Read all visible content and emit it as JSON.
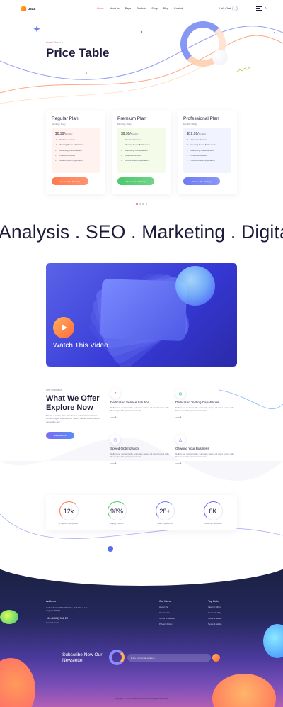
{
  "header": {
    "logo_text": "ucas",
    "nav": [
      "Home",
      "About us",
      "Page",
      "Portfolio",
      "Shop",
      "Blog",
      "Contact"
    ],
    "active_nav": "Home",
    "chat_label": "Let's Chat",
    "icons": [
      "menu-icon",
      "search-icon"
    ]
  },
  "hero": {
    "breadcrumb_home": "Home",
    "breadcrumb_sep": "/",
    "breadcrumb_current": "About Us",
    "title": "Price Table"
  },
  "pricing": {
    "plans": [
      {
        "name": "Regular Plan",
        "period": "Monthly / Daily",
        "price": "$0.99/",
        "price_unit": "Monthly",
        "features": [
          "10 Hours Access",
          "Meeting Room $2/Hr Hour",
          "Marketing Consultations",
          "Financial Access",
          "Customizable registration"
        ],
        "button": "Choose The Package",
        "accent": "#ff7a4d",
        "box_bg": "#fff2ef"
      },
      {
        "name": "Premium Plan",
        "period": "Monthly / Daily",
        "price": "$9.99/",
        "price_unit": "Monthly",
        "features": [
          "10 Hours Access",
          "Meeting Room $2/Hr Hour",
          "Marketing Consultations",
          "Financial Access",
          "Customizable registration"
        ],
        "button": "Choose The Package",
        "accent": "#4cc96b",
        "box_bg": "#f4fbe9"
      },
      {
        "name": "Professional Plan",
        "period": "Monthly / Daily",
        "price": "$19.99/",
        "price_unit": "Monthly",
        "features": [
          "10 Hours Access",
          "Meeting Room $2/Hr Hour",
          "Marketing Consultations",
          "Financial Access",
          "Customizable registration"
        ],
        "button": "Choose The Package",
        "accent": "#6d7cf5",
        "box_bg": "#f1f3ff"
      }
    ]
  },
  "marquee": "Analysis . SEO . Marketing . Digital",
  "video": {
    "label": "Watch This Video"
  },
  "offer": {
    "tag": "Why Choose Us",
    "title": "What We Offer Explore Now",
    "description": "Mauris ut lectus vitae. Vestibulum volutpat in sed lacus. Donec fringilla viverra porta. Mauris metus, quam efficitur nec varius sed.",
    "button": "View Service",
    "services": [
      {
        "title": "Dedicated Service Solution",
        "text": "Nullam vel metus mattis, vulputate sapien sit amet, luctus odio. Donec gravida gravida commodo.",
        "icon": "chart-icon"
      },
      {
        "title": "Dedicated Testing Capabilities",
        "text": "Nullam vel metus mattis, vulputate sapien sit amet, luctus odio. Donec gravida gravida commodo.",
        "icon": "test-icon"
      },
      {
        "title": "Speed Optimization",
        "text": "Nullam vel metus mattis, vulputate sapien sit amet, luctus odio. Donec gravida gravida commodo.",
        "icon": "speed-icon"
      },
      {
        "title": "Growing Your Business",
        "text": "Nullam vel metus mattis, vulputate sapien sit amet, luctus odio. Donec gravida gravida commodo.",
        "icon": "growth-icon"
      }
    ]
  },
  "stats": [
    {
      "value": "12k",
      "label": "Projects Completed",
      "color": "#ff7a4d"
    },
    {
      "value": "98%",
      "label": "Happy Clients",
      "color": "#4cc96b"
    },
    {
      "value": "28+",
      "label": "Years Experience",
      "color": "#6d7cf5"
    },
    {
      "value": "8K",
      "label": "Customer Services",
      "color": "#8b5cf6"
    }
  ],
  "footer": {
    "address_head": "Address",
    "address_text": "United States Web Whitefox, 2nd Street Los Angeles 90024",
    "phone": "+00 (0000) 956 22",
    "email": "Contact Form",
    "menu_head": "Our Menu",
    "menu_items": [
      "About Us",
      "Contact Us",
      "Terms of service",
      "Privacy Policy"
    ],
    "links_head": "Top Links",
    "links_items": [
      "Ideal to Hiring",
      "Cookie Policy",
      "News & Media",
      "News & Media"
    ],
    "subscribe": "Subscribe Now Our Newsletter",
    "email_placeholder": "Enter your email address...",
    "copyright": "Copyright © 2023 Ucas by company. All Rights Reserved."
  }
}
